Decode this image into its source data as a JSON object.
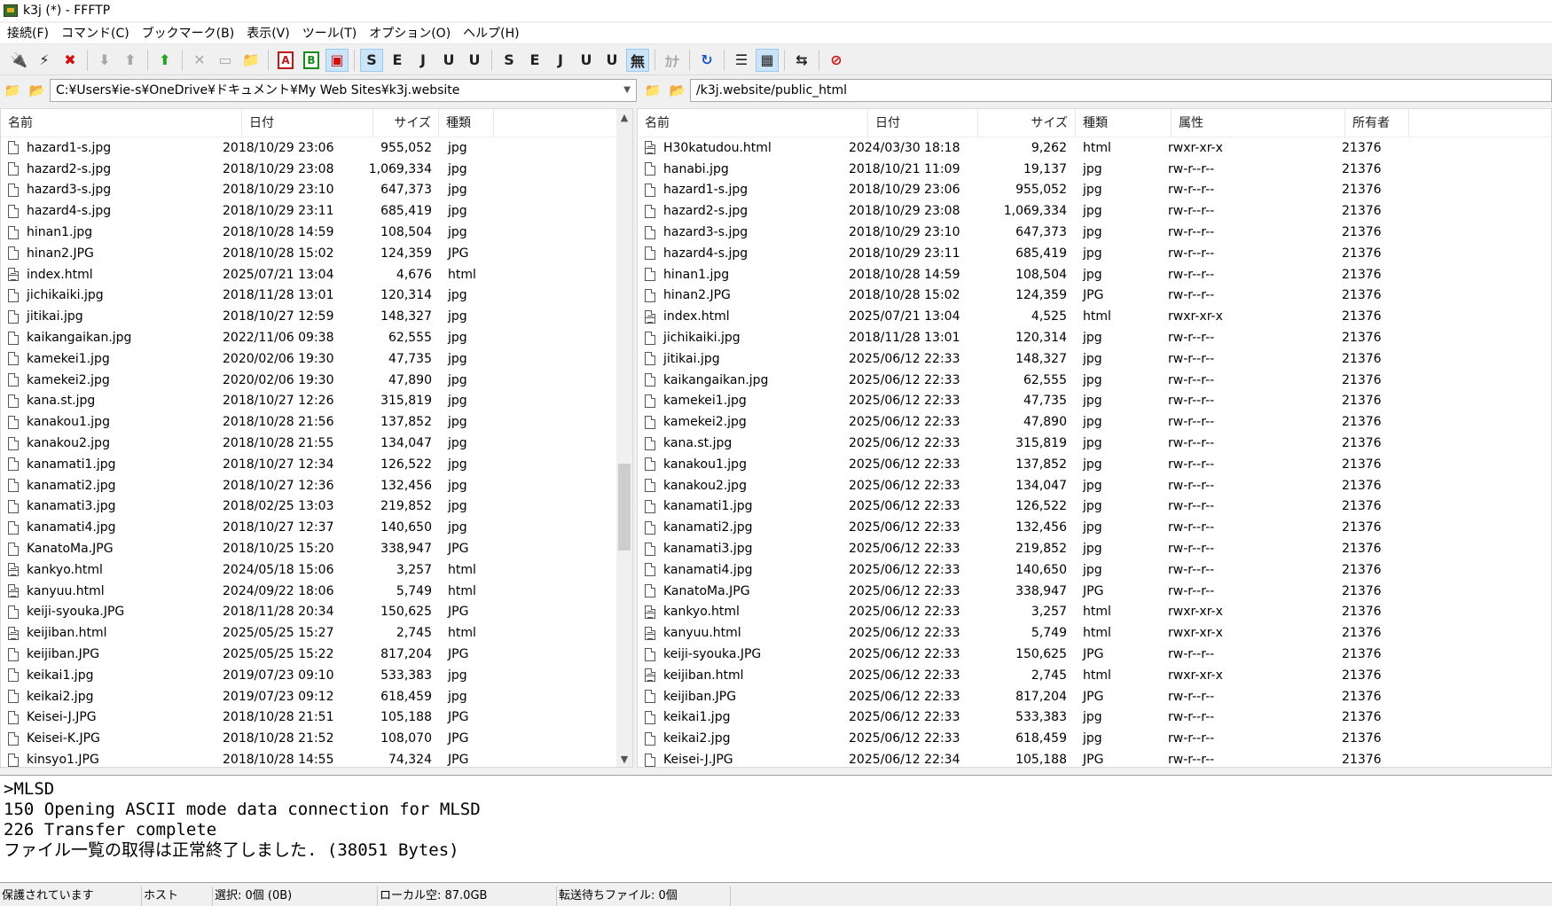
{
  "window": {
    "title": "k3j (*) - FFFTP"
  },
  "menu": [
    "接続(F)",
    "コマンド(C)",
    "ブックマーク(B)",
    "表示(V)",
    "ツール(T)",
    "オプション(O)",
    "ヘルプ(H)"
  ],
  "toolbar": {
    "buttons": [
      {
        "name": "connect",
        "glyph": "🔌",
        "icon": "plug-icon",
        "style": "red"
      },
      {
        "name": "quick-connect",
        "glyph": "⚡",
        "icon": "lightning-icon",
        "style": ""
      },
      {
        "name": "disconnect",
        "glyph": "✖",
        "icon": "disconnect-icon",
        "style": "red"
      },
      {
        "name": "sep1"
      },
      {
        "name": "download",
        "glyph": "⬇",
        "icon": "arrow-down-icon",
        "style": "disabled"
      },
      {
        "name": "upload",
        "glyph": "⬆",
        "icon": "arrow-up-icon",
        "style": "disabled"
      },
      {
        "name": "sep2"
      },
      {
        "name": "mirror-upload",
        "glyph": "⬆",
        "icon": "mirror-up-icon",
        "style": "green"
      },
      {
        "name": "sep3"
      },
      {
        "name": "delete",
        "glyph": "✕",
        "icon": "delete-icon",
        "style": "disabled"
      },
      {
        "name": "rename",
        "glyph": "▭",
        "icon": "rename-icon",
        "style": "disabled"
      },
      {
        "name": "mkdir",
        "glyph": "📁",
        "icon": "new-folder-icon",
        "style": ""
      },
      {
        "name": "sep4"
      },
      {
        "name": "mode-ascii",
        "glyph": "A",
        "icon": "ascii-mode-icon",
        "style": "boxed"
      },
      {
        "name": "mode-binary",
        "glyph": "B",
        "icon": "binary-mode-icon",
        "style": "boxed-g"
      },
      {
        "name": "mode-auto",
        "glyph": "▣",
        "icon": "auto-mode-icon",
        "style": "toggled red"
      },
      {
        "name": "sep5"
      },
      {
        "name": "kanji-sjis-host",
        "glyph": "S",
        "icon": "sjis-icon",
        "style": "toggled"
      },
      {
        "name": "kanji-euc-host",
        "glyph": "E",
        "icon": "euc-icon",
        "style": ""
      },
      {
        "name": "kanji-jis-host",
        "glyph": "J",
        "icon": "jis-icon",
        "style": ""
      },
      {
        "name": "kanji-utf8-host",
        "glyph": "U",
        "icon": "utf8-icon",
        "style": ""
      },
      {
        "name": "kanji-utf8bom-host",
        "glyph": "U",
        "icon": "utf8-bom-icon",
        "style": ""
      },
      {
        "name": "sep6"
      },
      {
        "name": "kanji-sjis-local",
        "glyph": "S",
        "icon": "sjis-icon",
        "style": ""
      },
      {
        "name": "kanji-euc-local",
        "glyph": "E",
        "icon": "euc-icon",
        "style": ""
      },
      {
        "name": "kanji-jis-local",
        "glyph": "J",
        "icon": "jis-icon",
        "style": ""
      },
      {
        "name": "kanji-utf8-local",
        "glyph": "U",
        "icon": "utf8-icon",
        "style": ""
      },
      {
        "name": "kanji-utf8bom-local",
        "glyph": "U",
        "icon": "utf8-bom-icon",
        "style": ""
      },
      {
        "name": "no-convert",
        "glyph": "無",
        "icon": "no-convert-icon",
        "style": "toggled"
      },
      {
        "name": "sep7"
      },
      {
        "name": "kana-convert",
        "glyph": "ｶﾅ",
        "icon": "kana-icon",
        "style": "disabled"
      },
      {
        "name": "sep8"
      },
      {
        "name": "refresh",
        "glyph": "↻",
        "icon": "refresh-icon",
        "style": "blue"
      },
      {
        "name": "sep9"
      },
      {
        "name": "list-view",
        "glyph": "☰",
        "icon": "list-view-icon",
        "style": ""
      },
      {
        "name": "detail-view",
        "glyph": "▦",
        "icon": "detail-view-icon",
        "style": "toggled"
      },
      {
        "name": "sep10"
      },
      {
        "name": "sync-tree",
        "glyph": "⇆",
        "icon": "sync-tree-icon",
        "style": ""
      },
      {
        "name": "sep11"
      },
      {
        "name": "abort",
        "glyph": "⊘",
        "icon": "abort-icon",
        "style": "red"
      }
    ]
  },
  "local": {
    "path": "C:¥Users¥ie-s¥OneDrive¥ドキュメント¥My Web Sites¥k3j.website",
    "headers": {
      "name": "名前",
      "date": "日付",
      "size": "サイズ",
      "ext": "種類"
    },
    "files": [
      {
        "name": "hazard1-s.jpg",
        "date": "2018/10/29 23:06",
        "size": "955,052",
        "ext": "jpg",
        "type": "file"
      },
      {
        "name": "hazard2-s.jpg",
        "date": "2018/10/29 23:08",
        "size": "1,069,334",
        "ext": "jpg",
        "type": "file"
      },
      {
        "name": "hazard3-s.jpg",
        "date": "2018/10/29 23:10",
        "size": "647,373",
        "ext": "jpg",
        "type": "file"
      },
      {
        "name": "hazard4-s.jpg",
        "date": "2018/10/29 23:11",
        "size": "685,419",
        "ext": "jpg",
        "type": "file"
      },
      {
        "name": "hinan1.jpg",
        "date": "2018/10/28 14:59",
        "size": "108,504",
        "ext": "jpg",
        "type": "file"
      },
      {
        "name": "hinan2.JPG",
        "date": "2018/10/28 15:02",
        "size": "124,359",
        "ext": "JPG",
        "type": "file"
      },
      {
        "name": "index.html",
        "date": "2025/07/21 13:04",
        "size": "4,676",
        "ext": "html",
        "type": "html"
      },
      {
        "name": "jichikaiki.jpg",
        "date": "2018/11/28 13:01",
        "size": "120,314",
        "ext": "jpg",
        "type": "file"
      },
      {
        "name": "jitikai.jpg",
        "date": "2018/10/27 12:59",
        "size": "148,327",
        "ext": "jpg",
        "type": "file"
      },
      {
        "name": "kaikangaikan.jpg",
        "date": "2022/11/06 09:38",
        "size": "62,555",
        "ext": "jpg",
        "type": "file"
      },
      {
        "name": "kamekei1.jpg",
        "date": "2020/02/06 19:30",
        "size": "47,735",
        "ext": "jpg",
        "type": "file"
      },
      {
        "name": "kamekei2.jpg",
        "date": "2020/02/06 19:30",
        "size": "47,890",
        "ext": "jpg",
        "type": "file"
      },
      {
        "name": "kana.st.jpg",
        "date": "2018/10/27 12:26",
        "size": "315,819",
        "ext": "jpg",
        "type": "file"
      },
      {
        "name": "kanakou1.jpg",
        "date": "2018/10/28 21:56",
        "size": "137,852",
        "ext": "jpg",
        "type": "file"
      },
      {
        "name": "kanakou2.jpg",
        "date": "2018/10/28 21:55",
        "size": "134,047",
        "ext": "jpg",
        "type": "file"
      },
      {
        "name": "kanamati1.jpg",
        "date": "2018/10/27 12:34",
        "size": "126,522",
        "ext": "jpg",
        "type": "file"
      },
      {
        "name": "kanamati2.jpg",
        "date": "2018/10/27 12:36",
        "size": "132,456",
        "ext": "jpg",
        "type": "file"
      },
      {
        "name": "kanamati3.jpg",
        "date": "2018/02/25 13:03",
        "size": "219,852",
        "ext": "jpg",
        "type": "file"
      },
      {
        "name": "kanamati4.jpg",
        "date": "2018/10/27 12:37",
        "size": "140,650",
        "ext": "jpg",
        "type": "file"
      },
      {
        "name": "KanatoMa.JPG",
        "date": "2018/10/25 15:20",
        "size": "338,947",
        "ext": "JPG",
        "type": "file"
      },
      {
        "name": "kankyo.html",
        "date": "2024/05/18 15:06",
        "size": "3,257",
        "ext": "html",
        "type": "html"
      },
      {
        "name": "kanyuu.html",
        "date": "2024/09/22 18:06",
        "size": "5,749",
        "ext": "html",
        "type": "html"
      },
      {
        "name": "keiji-syouka.JPG",
        "date": "2018/11/28 20:34",
        "size": "150,625",
        "ext": "JPG",
        "type": "file"
      },
      {
        "name": "keijiban.html",
        "date": "2025/05/25 15:27",
        "size": "2,745",
        "ext": "html",
        "type": "html"
      },
      {
        "name": "keijiban.JPG",
        "date": "2025/05/25 15:22",
        "size": "817,204",
        "ext": "JPG",
        "type": "file"
      },
      {
        "name": "keikai1.jpg",
        "date": "2019/07/23 09:10",
        "size": "533,383",
        "ext": "jpg",
        "type": "file"
      },
      {
        "name": "keikai2.jpg",
        "date": "2019/07/23 09:12",
        "size": "618,459",
        "ext": "jpg",
        "type": "file"
      },
      {
        "name": "Keisei-J.JPG",
        "date": "2018/10/28 21:51",
        "size": "105,188",
        "ext": "JPG",
        "type": "file"
      },
      {
        "name": "Keisei-K.JPG",
        "date": "2018/10/28 21:52",
        "size": "108,070",
        "ext": "JPG",
        "type": "file"
      },
      {
        "name": "kinsyo1.JPG",
        "date": "2018/10/28 14:55",
        "size": "74,324",
        "ext": "JPG",
        "type": "file"
      }
    ]
  },
  "remote": {
    "path": "/k3j.website/public_html",
    "headers": {
      "name": "名前",
      "date": "日付",
      "size": "サイズ",
      "ext": "種類",
      "attr": "属性",
      "owner": "所有者"
    },
    "files": [
      {
        "name": "H30katudou.html",
        "date": "2024/03/30 18:18",
        "size": "9,262",
        "ext": "html",
        "attr": "rwxr-xr-x",
        "owner": "21376",
        "type": "html"
      },
      {
        "name": "hanabi.jpg",
        "date": "2018/10/21 11:09",
        "size": "19,137",
        "ext": "jpg",
        "attr": "rw-r--r--",
        "owner": "21376",
        "type": "file"
      },
      {
        "name": "hazard1-s.jpg",
        "date": "2018/10/29 23:06",
        "size": "955,052",
        "ext": "jpg",
        "attr": "rw-r--r--",
        "owner": "21376",
        "type": "file"
      },
      {
        "name": "hazard2-s.jpg",
        "date": "2018/10/29 23:08",
        "size": "1,069,334",
        "ext": "jpg",
        "attr": "rw-r--r--",
        "owner": "21376",
        "type": "file"
      },
      {
        "name": "hazard3-s.jpg",
        "date": "2018/10/29 23:10",
        "size": "647,373",
        "ext": "jpg",
        "attr": "rw-r--r--",
        "owner": "21376",
        "type": "file"
      },
      {
        "name": "hazard4-s.jpg",
        "date": "2018/10/29 23:11",
        "size": "685,419",
        "ext": "jpg",
        "attr": "rw-r--r--",
        "owner": "21376",
        "type": "file"
      },
      {
        "name": "hinan1.jpg",
        "date": "2018/10/28 14:59",
        "size": "108,504",
        "ext": "jpg",
        "attr": "rw-r--r--",
        "owner": "21376",
        "type": "file"
      },
      {
        "name": "hinan2.JPG",
        "date": "2018/10/28 15:02",
        "size": "124,359",
        "ext": "JPG",
        "attr": "rw-r--r--",
        "owner": "21376",
        "type": "file"
      },
      {
        "name": "index.html",
        "date": "2025/07/21 13:04",
        "size": "4,525",
        "ext": "html",
        "attr": "rwxr-xr-x",
        "owner": "21376",
        "type": "html"
      },
      {
        "name": "jichikaiki.jpg",
        "date": "2018/11/28 13:01",
        "size": "120,314",
        "ext": "jpg",
        "attr": "rw-r--r--",
        "owner": "21376",
        "type": "file"
      },
      {
        "name": "jitikai.jpg",
        "date": "2025/06/12 22:33",
        "size": "148,327",
        "ext": "jpg",
        "attr": "rw-r--r--",
        "owner": "21376",
        "type": "file"
      },
      {
        "name": "kaikangaikan.jpg",
        "date": "2025/06/12 22:33",
        "size": "62,555",
        "ext": "jpg",
        "attr": "rw-r--r--",
        "owner": "21376",
        "type": "file"
      },
      {
        "name": "kamekei1.jpg",
        "date": "2025/06/12 22:33",
        "size": "47,735",
        "ext": "jpg",
        "attr": "rw-r--r--",
        "owner": "21376",
        "type": "file"
      },
      {
        "name": "kamekei2.jpg",
        "date": "2025/06/12 22:33",
        "size": "47,890",
        "ext": "jpg",
        "attr": "rw-r--r--",
        "owner": "21376",
        "type": "file"
      },
      {
        "name": "kana.st.jpg",
        "date": "2025/06/12 22:33",
        "size": "315,819",
        "ext": "jpg",
        "attr": "rw-r--r--",
        "owner": "21376",
        "type": "file"
      },
      {
        "name": "kanakou1.jpg",
        "date": "2025/06/12 22:33",
        "size": "137,852",
        "ext": "jpg",
        "attr": "rw-r--r--",
        "owner": "21376",
        "type": "file"
      },
      {
        "name": "kanakou2.jpg",
        "date": "2025/06/12 22:33",
        "size": "134,047",
        "ext": "jpg",
        "attr": "rw-r--r--",
        "owner": "21376",
        "type": "file"
      },
      {
        "name": "kanamati1.jpg",
        "date": "2025/06/12 22:33",
        "size": "126,522",
        "ext": "jpg",
        "attr": "rw-r--r--",
        "owner": "21376",
        "type": "file"
      },
      {
        "name": "kanamati2.jpg",
        "date": "2025/06/12 22:33",
        "size": "132,456",
        "ext": "jpg",
        "attr": "rw-r--r--",
        "owner": "21376",
        "type": "file"
      },
      {
        "name": "kanamati3.jpg",
        "date": "2025/06/12 22:33",
        "size": "219,852",
        "ext": "jpg",
        "attr": "rw-r--r--",
        "owner": "21376",
        "type": "file"
      },
      {
        "name": "kanamati4.jpg",
        "date": "2025/06/12 22:33",
        "size": "140,650",
        "ext": "jpg",
        "attr": "rw-r--r--",
        "owner": "21376",
        "type": "file"
      },
      {
        "name": "KanatoMa.JPG",
        "date": "2025/06/12 22:33",
        "size": "338,947",
        "ext": "JPG",
        "attr": "rw-r--r--",
        "owner": "21376",
        "type": "file"
      },
      {
        "name": "kankyo.html",
        "date": "2025/06/12 22:33",
        "size": "3,257",
        "ext": "html",
        "attr": "rwxr-xr-x",
        "owner": "21376",
        "type": "html"
      },
      {
        "name": "kanyuu.html",
        "date": "2025/06/12 22:33",
        "size": "5,749",
        "ext": "html",
        "attr": "rwxr-xr-x",
        "owner": "21376",
        "type": "html"
      },
      {
        "name": "keiji-syouka.JPG",
        "date": "2025/06/12 22:33",
        "size": "150,625",
        "ext": "JPG",
        "attr": "rw-r--r--",
        "owner": "21376",
        "type": "file"
      },
      {
        "name": "keijiban.html",
        "date": "2025/06/12 22:33",
        "size": "2,745",
        "ext": "html",
        "attr": "rwxr-xr-x",
        "owner": "21376",
        "type": "html"
      },
      {
        "name": "keijiban.JPG",
        "date": "2025/06/12 22:33",
        "size": "817,204",
        "ext": "JPG",
        "attr": "rw-r--r--",
        "owner": "21376",
        "type": "file"
      },
      {
        "name": "keikai1.jpg",
        "date": "2025/06/12 22:33",
        "size": "533,383",
        "ext": "jpg",
        "attr": "rw-r--r--",
        "owner": "21376",
        "type": "file"
      },
      {
        "name": "keikai2.jpg",
        "date": "2025/06/12 22:33",
        "size": "618,459",
        "ext": "jpg",
        "attr": "rw-r--r--",
        "owner": "21376",
        "type": "file"
      },
      {
        "name": "Keisei-J.JPG",
        "date": "2025/06/12 22:34",
        "size": "105,188",
        "ext": "JPG",
        "attr": "rw-r--r--",
        "owner": "21376",
        "type": "file"
      }
    ]
  },
  "log": [
    ">MLSD",
    "150 Opening ASCII mode data connection for MLSD",
    "226 Transfer complete",
    "ファイル一覧の取得は正常終了しました. (38051 Bytes)"
  ],
  "status": {
    "security": "保護されています",
    "host": "ホスト",
    "selection": "選択: 0個 (0B)",
    "local_free": "ローカル空: 87.0GB",
    "queue": "転送待ちファイル: 0個"
  }
}
